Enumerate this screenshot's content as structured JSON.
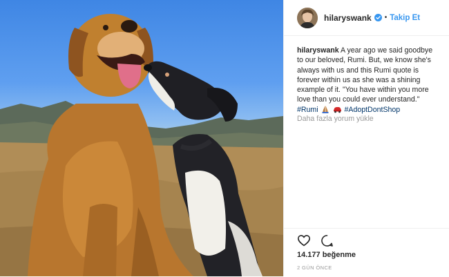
{
  "post": {
    "header": {
      "username": "hilaryswank",
      "separator": "•",
      "follow_label": "Takip Et"
    },
    "caption": {
      "username": "hilaryswank",
      "text": "A year ago we said goodbye to our beloved, Rumi. But, we know she's always with us and this Rumi quote is forever within us as she was a shining example of it. \"You have within you more love than you could ever understand.\"",
      "hashtag_1": "#Rumi",
      "hashtag_2": "#AdoptDontShop"
    },
    "view_more_comments": "Daha fazla yorum yükle",
    "likes": "14.177 beğenme",
    "timestamp": "2 GÜN ÖNCE",
    "icons": [
      "heart-icon",
      "comment-icon",
      "verified-badge-icon",
      "praying-hands-emoji",
      "car-emoji"
    ],
    "colors": {
      "link": "#3897f0",
      "hashtag": "#003569",
      "muted": "#999999",
      "text": "#262626"
    }
  }
}
